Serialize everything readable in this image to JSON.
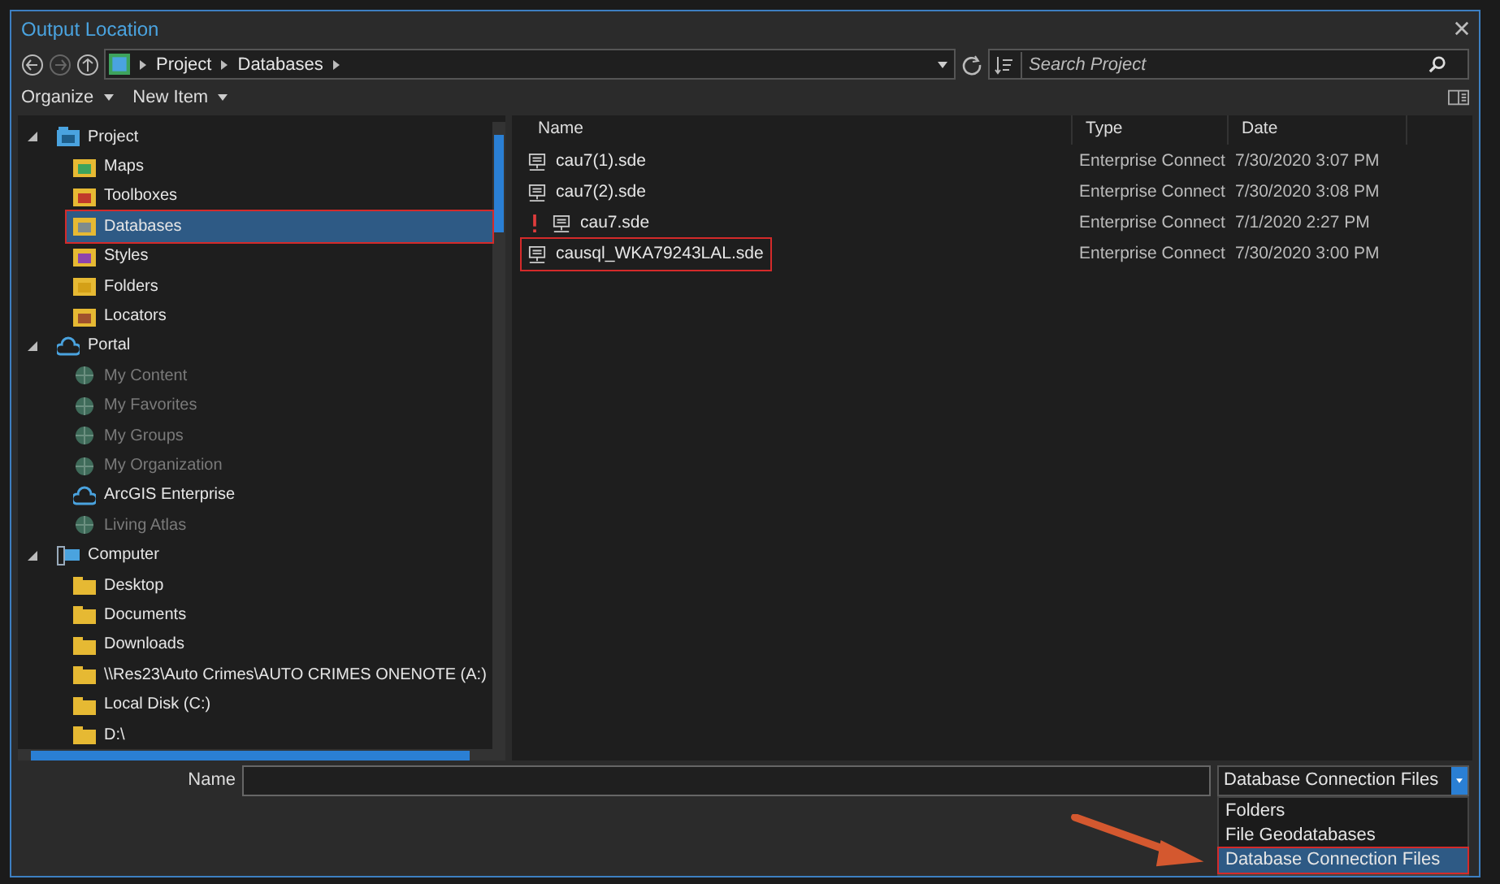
{
  "window": {
    "title": "Output Location"
  },
  "address_bar": {
    "path": [
      "Project",
      "Databases"
    ],
    "search": {
      "placeholder": "Search Project"
    }
  },
  "toolbar": [
    {
      "label": "Organize"
    },
    {
      "label": "New Item"
    }
  ],
  "tree": [
    {
      "label": "Project",
      "kind": "project",
      "expanded": true,
      "children": [
        {
          "label": "Maps",
          "kind": "map",
          "selected": false,
          "dimmed": false,
          "highlighted": false
        },
        {
          "label": "Toolboxes",
          "kind": "toolbox",
          "selected": false,
          "dimmed": false,
          "highlighted": false
        },
        {
          "label": "Databases",
          "kind": "database",
          "selected": true,
          "dimmed": false,
          "highlighted": true
        },
        {
          "label": "Styles",
          "kind": "style",
          "selected": false,
          "dimmed": false,
          "highlighted": false
        },
        {
          "label": "Folders",
          "kind": "folder",
          "selected": false,
          "dimmed": false,
          "highlighted": false
        },
        {
          "label": "Locators",
          "kind": "locator",
          "selected": false,
          "dimmed": false,
          "highlighted": false
        }
      ]
    },
    {
      "label": "Portal",
      "kind": "portal",
      "expanded": true,
      "children": [
        {
          "label": "My Content",
          "kind": "globe",
          "selected": false,
          "dimmed": true,
          "highlighted": false
        },
        {
          "label": "My Favorites",
          "kind": "globe",
          "selected": false,
          "dimmed": true,
          "highlighted": false
        },
        {
          "label": "My Groups",
          "kind": "globe",
          "selected": false,
          "dimmed": true,
          "highlighted": false
        },
        {
          "label": "My Organization",
          "kind": "globe",
          "selected": false,
          "dimmed": true,
          "highlighted": false
        },
        {
          "label": "ArcGIS Enterprise",
          "kind": "portal",
          "selected": false,
          "dimmed": false,
          "highlighted": false
        },
        {
          "label": "Living Atlas",
          "kind": "globe",
          "selected": false,
          "dimmed": true,
          "highlighted": false
        }
      ]
    },
    {
      "label": "Computer",
      "kind": "computer",
      "expanded": true,
      "children": [
        {
          "label": "Desktop",
          "kind": "drive",
          "selected": false,
          "dimmed": false,
          "highlighted": false
        },
        {
          "label": "Documents",
          "kind": "drive",
          "selected": false,
          "dimmed": false,
          "highlighted": false
        },
        {
          "label": "Downloads",
          "kind": "drive",
          "selected": false,
          "dimmed": false,
          "highlighted": false
        },
        {
          "label": "\\\\Res23\\Auto Crimes\\AUTO CRIMES ONENOTE (A:)",
          "kind": "drive",
          "selected": false,
          "dimmed": false,
          "highlighted": false
        },
        {
          "label": "Local Disk (C:)",
          "kind": "drive",
          "selected": false,
          "dimmed": false,
          "highlighted": false
        },
        {
          "label": "D:\\",
          "kind": "drive",
          "selected": false,
          "dimmed": false,
          "highlighted": false
        }
      ]
    }
  ],
  "file_list": {
    "columns": [
      "Name",
      "Type",
      "Date"
    ],
    "rows": [
      {
        "name": "cau7(1).sde",
        "type": "Enterprise Connect",
        "date": "7/30/2020 3:07 PM",
        "warning": false,
        "highlighted": false
      },
      {
        "name": "cau7(2).sde",
        "type": "Enterprise Connect",
        "date": "7/30/2020 3:08 PM",
        "warning": false,
        "highlighted": false
      },
      {
        "name": "cau7.sde",
        "type": "Enterprise Connect",
        "date": "7/1/2020 2:27 PM",
        "warning": true,
        "highlighted": false
      },
      {
        "name": "causql_WKA79243LAL.sde",
        "type": "Enterprise Connect",
        "date": "7/30/2020 3:00 PM",
        "warning": false,
        "highlighted": true
      }
    ]
  },
  "name_field": {
    "label": "Name"
  },
  "filter_dropdown": {
    "value": "Database Connection Files",
    "expanded": true,
    "options": [
      {
        "label": "Folders",
        "selected": false,
        "highlighted": false
      },
      {
        "label": "File Geodatabases",
        "selected": false,
        "highlighted": false
      },
      {
        "label": "Database Connection Files",
        "selected": true,
        "highlighted": true
      }
    ]
  }
}
